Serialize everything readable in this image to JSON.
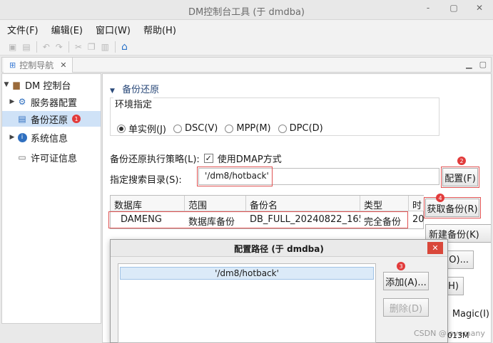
{
  "window": {
    "title": "DM控制台工具 (于 dmdba)",
    "controls": [
      "-",
      "▢",
      "✕"
    ]
  },
  "menu": [
    "文件(F)",
    "编辑(E)",
    "窗口(W)",
    "帮助(H)"
  ],
  "view_tab": {
    "label": "控制导航",
    "close": "✕"
  },
  "nav": {
    "root": "DM 控制台",
    "items": [
      {
        "label": "服务器配置"
      },
      {
        "label": "备份还原",
        "badge": "1"
      },
      {
        "label": "系统信息"
      },
      {
        "label": "许可证信息"
      }
    ]
  },
  "backup": {
    "section_title": "备份还原",
    "env_label": "环境指定",
    "env_options": [
      "单实例(J)",
      "DSC(V)",
      "MPP(M)",
      "DPC(D)"
    ],
    "env_selected": 0,
    "strategy_label": "备份还原执行策略(L):",
    "strategy_checkbox": "使用DMAP方式",
    "strategy_checked": true,
    "dir_label": "指定搜索目录(S):",
    "dir_value": "'/dm8/hotback'",
    "config_button": "配置(F)",
    "config_badge": "2",
    "table": {
      "columns": [
        "数据库",
        "范围",
        "备份名",
        "类型",
        "时"
      ],
      "rows": [
        [
          "DAMENG",
          "数据库备份",
          "DB_FULL_20240822_165...",
          "完全备份",
          "20"
        ]
      ]
    },
    "get_backup_button": "获取备份(R)",
    "get_backup_badge": "4",
    "new_backup_button": "新建备份(K)",
    "partial_buttons": [
      "O)...",
      "H)",
      "Magic(I)"
    ]
  },
  "dialog": {
    "title": "配置路径 (于 dmdba)",
    "close": "✕",
    "paths": [
      "'/dm8/hotback'"
    ],
    "add_button": "添加(A)...",
    "add_badge": "3",
    "delete_button": "删除(D)"
  },
  "status": {
    "memory": "013M"
  },
  "watermark": "CSDN @lovemany"
}
